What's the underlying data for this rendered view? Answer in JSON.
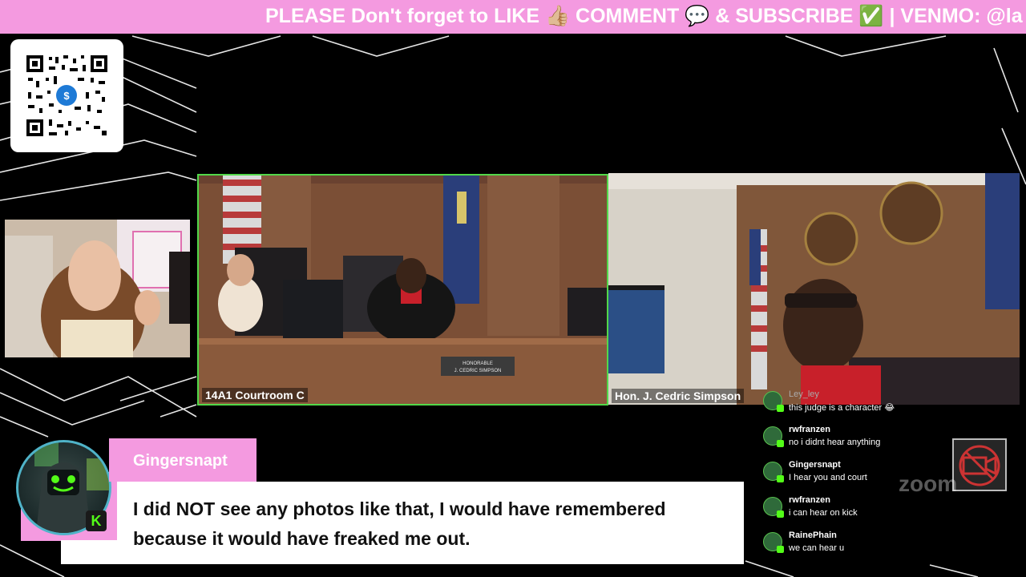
{
  "ticker": {
    "text": "PLEASE Don't forget to LIKE 👍🏼 COMMENT 💬 & SUBSCRIBE ✅ | VENMO: @la"
  },
  "video": {
    "left_panel_label": "14A1 Courtroom C",
    "right_panel_label": "Hon. J. Cedric Simpson",
    "nameplate": "HONORABLE J. CEDRIC SIMPSON",
    "watermark": "zoom"
  },
  "chat": {
    "messages": [
      {
        "user": "Ley_ley",
        "text": "this judge is a character 😂"
      },
      {
        "user": "rwfranzen",
        "text": "no i didnt hear anything"
      },
      {
        "user": "Gingersnapt",
        "text": "I hear you and court"
      },
      {
        "user": "rwfranzen",
        "text": "i can hear on kick"
      },
      {
        "user": "RainePhain",
        "text": "we can hear u"
      }
    ]
  },
  "highlight": {
    "username": "Gingersnapt",
    "message": "I did NOT see any photos like that, I would have remembered because it would have freaked me out.",
    "badge_icon": "kick-icon",
    "badge_text": "K"
  },
  "colors": {
    "accent_pink": "#f49ae0",
    "kick_green": "#53fc18",
    "active_speaker_border": "#52d84a"
  }
}
